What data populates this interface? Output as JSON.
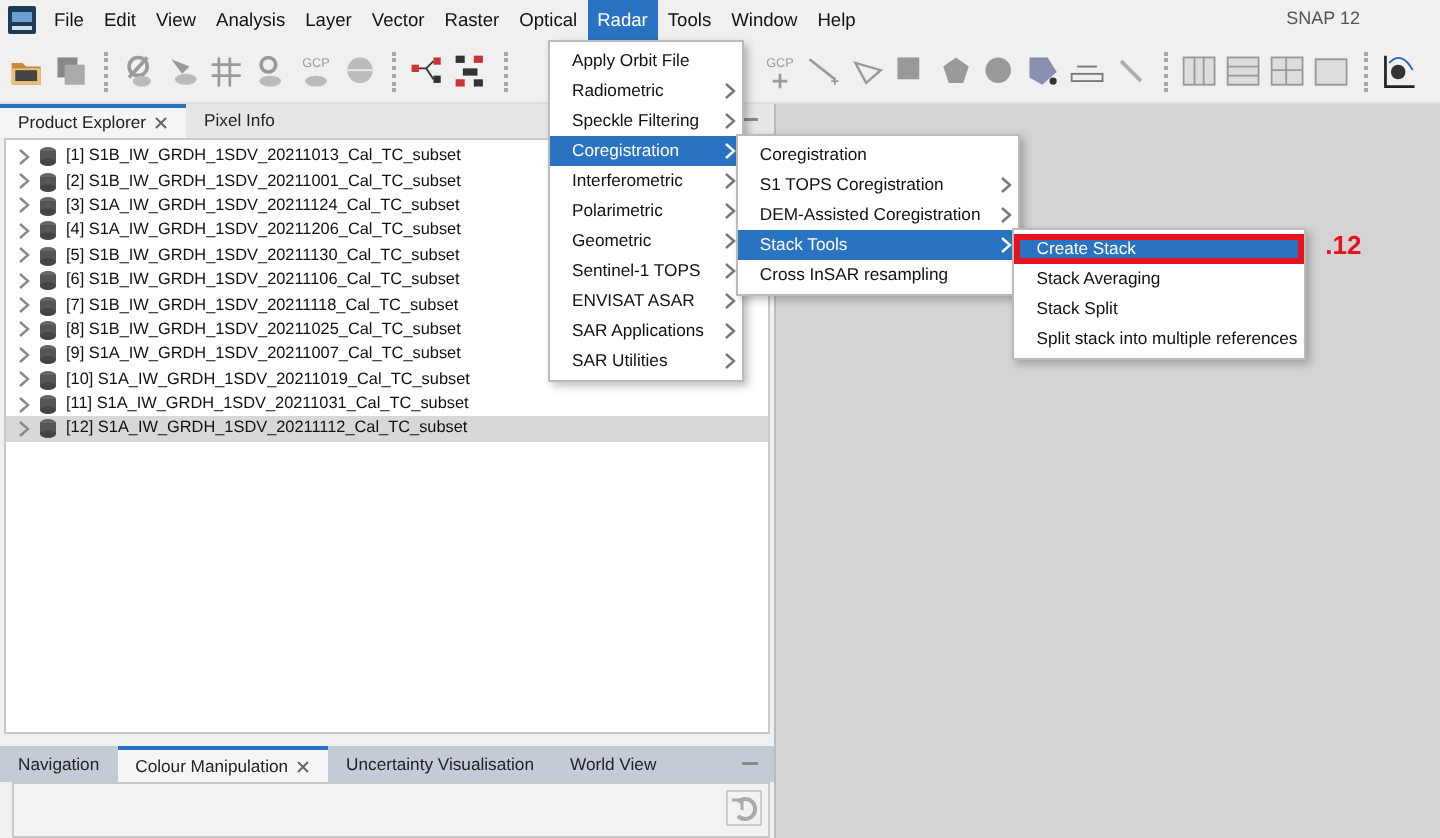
{
  "app_title": "SNAP 12",
  "menubar": [
    {
      "label": "File",
      "selected": false
    },
    {
      "label": "Edit",
      "selected": false
    },
    {
      "label": "View",
      "selected": false
    },
    {
      "label": "Analysis",
      "selected": false
    },
    {
      "label": "Layer",
      "selected": false
    },
    {
      "label": "Vector",
      "selected": false
    },
    {
      "label": "Raster",
      "selected": false
    },
    {
      "label": "Optical",
      "selected": false
    },
    {
      "label": "Radar",
      "selected": true
    },
    {
      "label": "Tools",
      "selected": false
    },
    {
      "label": "Window",
      "selected": false
    },
    {
      "label": "Help",
      "selected": false
    }
  ],
  "toolbar": [
    {
      "kind": "open"
    },
    {
      "kind": "save"
    },
    {
      "kind": "sep"
    },
    {
      "kind": "pin-off"
    },
    {
      "kind": "pin-move"
    },
    {
      "kind": "grid"
    },
    {
      "kind": "magnifier"
    },
    {
      "kind": "gcp",
      "label": "GCP"
    },
    {
      "kind": "globe"
    },
    {
      "kind": "sep"
    },
    {
      "kind": "graph"
    },
    {
      "kind": "batch"
    },
    {
      "kind": "sep"
    },
    {
      "kind": "gcp-add",
      "label": "GCP"
    },
    {
      "kind": "line"
    },
    {
      "kind": "polyline"
    },
    {
      "kind": "rect"
    },
    {
      "kind": "polygon"
    },
    {
      "kind": "ellipse"
    },
    {
      "kind": "select"
    },
    {
      "kind": "measure"
    },
    {
      "kind": "wand"
    },
    {
      "kind": "sep"
    },
    {
      "kind": "tile-h"
    },
    {
      "kind": "tile-v"
    },
    {
      "kind": "tile-grid"
    },
    {
      "kind": "folder"
    },
    {
      "kind": "sep"
    },
    {
      "kind": "spectrum"
    }
  ],
  "left_panel": {
    "tabs": [
      {
        "label": "Product Explorer",
        "selected": true,
        "closable": true
      },
      {
        "label": "Pixel Info",
        "selected": false,
        "closable": false
      }
    ],
    "products": [
      {
        "label": "[1] S1B_IW_GRDH_1SDV_20211013_Cal_TC_subset",
        "selected": false
      },
      {
        "label": "[2] S1B_IW_GRDH_1SDV_20211001_Cal_TC_subset",
        "selected": false
      },
      {
        "label": "[3] S1A_IW_GRDH_1SDV_20211124_Cal_TC_subset",
        "selected": false
      },
      {
        "label": "[4] S1A_IW_GRDH_1SDV_20211206_Cal_TC_subset",
        "selected": false
      },
      {
        "label": "[5] S1B_IW_GRDH_1SDV_20211130_Cal_TC_subset",
        "selected": false
      },
      {
        "label": "[6] S1B_IW_GRDH_1SDV_20211106_Cal_TC_subset",
        "selected": false
      },
      {
        "label": "[7] S1B_IW_GRDH_1SDV_20211118_Cal_TC_subset",
        "selected": false
      },
      {
        "label": "[8] S1B_IW_GRDH_1SDV_20211025_Cal_TC_subset",
        "selected": false
      },
      {
        "label": "[9] S1A_IW_GRDH_1SDV_20211007_Cal_TC_subset",
        "selected": false
      },
      {
        "label": "[10] S1A_IW_GRDH_1SDV_20211019_Cal_TC_subset",
        "selected": false
      },
      {
        "label": "[11] S1A_IW_GRDH_1SDV_20211031_Cal_TC_subset",
        "selected": false
      },
      {
        "label": "[12] S1A_IW_GRDH_1SDV_20211112_Cal_TC_subset",
        "selected": true
      }
    ]
  },
  "bottom_panel": {
    "tabs": [
      {
        "label": "Navigation",
        "selected": false,
        "closable": false
      },
      {
        "label": "Colour Manipulation",
        "selected": true,
        "closable": true
      },
      {
        "label": "Uncertainty Visualisation",
        "selected": false,
        "closable": false
      },
      {
        "label": "World View",
        "selected": false,
        "closable": false
      }
    ]
  },
  "menus": [
    {
      "items": [
        {
          "label": "Apply Orbit File",
          "submenu": false,
          "selected": false
        },
        {
          "label": "Radiometric",
          "submenu": true,
          "selected": false
        },
        {
          "label": "Speckle Filtering",
          "submenu": true,
          "selected": false
        },
        {
          "label": "Coregistration",
          "submenu": true,
          "selected": true
        },
        {
          "label": "Interferometric",
          "submenu": true,
          "selected": false
        },
        {
          "label": "Polarimetric",
          "submenu": true,
          "selected": false
        },
        {
          "label": "Geometric",
          "submenu": true,
          "selected": false
        },
        {
          "label": "Sentinel-1 TOPS",
          "submenu": true,
          "selected": false
        },
        {
          "label": "ENVISAT ASAR",
          "submenu": true,
          "selected": false
        },
        {
          "label": "SAR Applications",
          "submenu": true,
          "selected": false
        },
        {
          "label": "SAR Utilities",
          "submenu": true,
          "selected": false
        }
      ]
    },
    {
      "items": [
        {
          "label": "Coregistration",
          "submenu": false,
          "selected": false
        },
        {
          "label": "S1 TOPS Coregistration",
          "submenu": true,
          "selected": false
        },
        {
          "label": "DEM-Assisted Coregistration",
          "submenu": true,
          "selected": false
        },
        {
          "label": "Stack Tools",
          "submenu": true,
          "selected": true
        },
        {
          "label": "Cross InSAR resampling",
          "submenu": false,
          "selected": false
        }
      ]
    },
    {
      "items": [
        {
          "label": "Create Stack",
          "submenu": false,
          "selected": true,
          "highlighted": true
        },
        {
          "label": "Stack Averaging",
          "submenu": false,
          "selected": false
        },
        {
          "label": "Stack Split",
          "submenu": false,
          "selected": false
        },
        {
          "label": "Split stack into multiple references",
          "submenu": false,
          "selected": false
        }
      ]
    }
  ],
  "annotation": ".12"
}
